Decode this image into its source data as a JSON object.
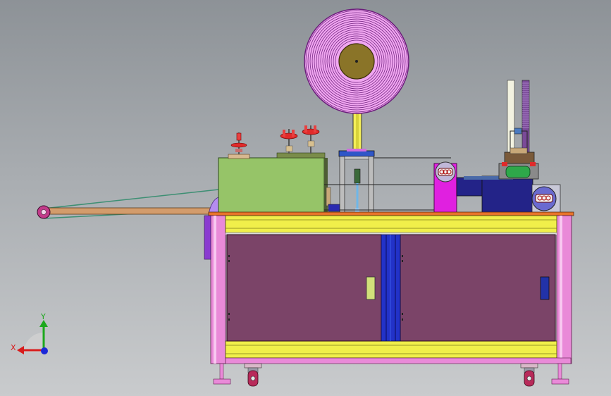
{
  "viewport": {
    "background": "#a9adb1"
  },
  "triad": {
    "x_label": "X",
    "y_label": "Y"
  },
  "colors": {
    "frame_pink": "#e98ad8",
    "rail_yellow": "#f0ef4a",
    "door_purple": "#7b4468",
    "center_blue": "#2232c8",
    "plate_orange": "#e8742a",
    "box_green": "#96c468",
    "reel_magenta": "#d060e0",
    "hub_olive": "#8a7428",
    "motor_navy": "#1f1f80"
  },
  "icons": {
    "reel": "spool-reel-icon",
    "caster": "caster-wheel-icon",
    "triad": "coordinate-triad-icon"
  }
}
